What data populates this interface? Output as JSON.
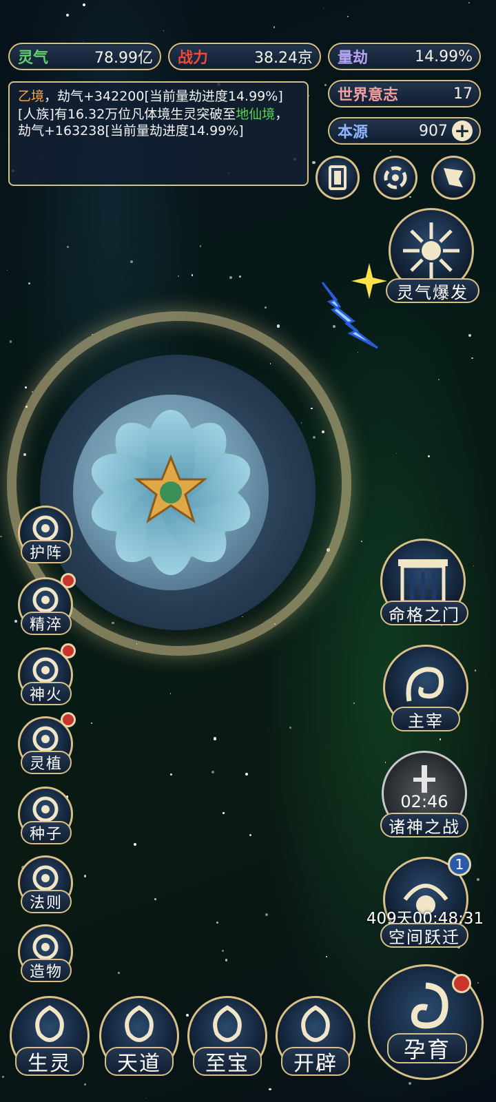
{
  "stats": {
    "lingqi": {
      "label": "灵气",
      "value": "78.99亿"
    },
    "zhanli": {
      "label": "战力",
      "value": "38.24京"
    },
    "liangjie": {
      "label": "量劫",
      "value": "14.99%"
    },
    "shijie_yizhi": {
      "label": "世界意志",
      "value": "17"
    },
    "benyuan": {
      "label": "本源",
      "value": "907",
      "plus": "+"
    }
  },
  "log": {
    "line1_realm": "乙境",
    "line1_rest": "，劫气+342200[当前量劫进度14.99%]",
    "line2_pre": "[人族]有16.32万位凡体境生灵突破至",
    "line2_realm": "地仙境",
    "line2_rest": "，劫气+163238[当前量劫进度14.99%]"
  },
  "right_buttons": {
    "burst": "灵气爆发",
    "fate_gate": "命格之门",
    "ruler": "主宰",
    "gods_war": "诸神之战",
    "gods_war_timer": "02:46",
    "space_jump": "空间跃迁",
    "space_jump_timer": "409天00:48:31",
    "space_jump_badge": "1",
    "nurture": "孕育"
  },
  "left_buttons": [
    "护阵",
    "精淬",
    "神火",
    "灵植",
    "种子",
    "法则",
    "造物"
  ],
  "bottom_nav": [
    "生灵",
    "天道",
    "至宝",
    "开辟"
  ],
  "colors": {
    "gold": "#d7c186",
    "lingqi": "#62d36a",
    "zhanli": "#ee4a3a",
    "liangjie": "#b6a3f2",
    "shijie": "#f0a0a0",
    "benyuan": "#8fb6ff"
  }
}
